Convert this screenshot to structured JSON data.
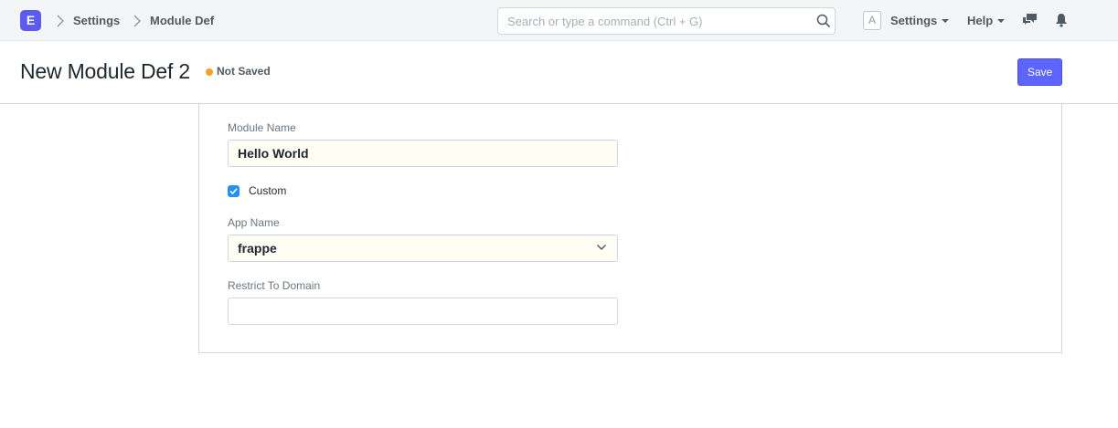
{
  "navbar": {
    "logo_letter": "E",
    "breadcrumbs": [
      "Settings",
      "Module Def"
    ],
    "search_placeholder": "Search or type a command (Ctrl + G)",
    "avatar_letter": "A",
    "settings_label": "Settings",
    "help_label": "Help"
  },
  "page": {
    "title": "New Module Def 2",
    "status": "Not Saved",
    "save_label": "Save"
  },
  "form": {
    "module_name_label": "Module Name",
    "module_name_value": "Hello World",
    "custom_label": "Custom",
    "custom_checked": true,
    "app_name_label": "App Name",
    "app_name_value": "frappe",
    "restrict_label": "Restrict To Domain",
    "restrict_value": ""
  },
  "colors": {
    "accent": "#5e64ff",
    "status_dot": "#f8a02c",
    "checkbox": "#2490ef"
  }
}
